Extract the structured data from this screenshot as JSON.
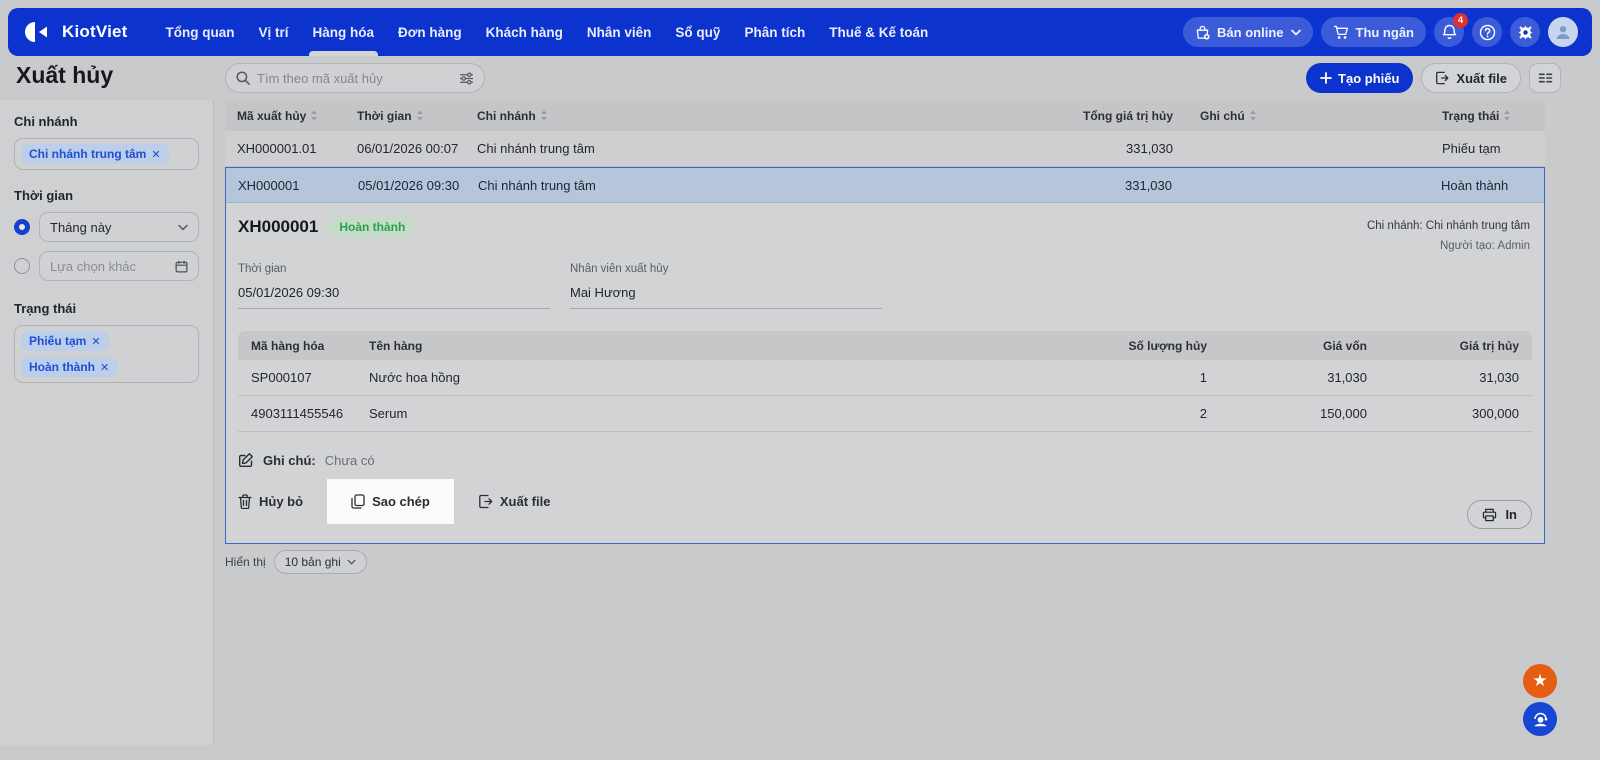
{
  "colors": {
    "brand_blue": "#0d33cf",
    "accent_blue": "#1c50d4",
    "notif_red": "#e03131",
    "badge_green_text": "#2f9e55",
    "badge_green_bg": "#c5ddc6",
    "selected_row_blue": "#b5c5db",
    "star_orange": "#e55d11"
  },
  "topbar": {
    "brand": "KiotViet",
    "nav": [
      {
        "label": "Tổng quan"
      },
      {
        "label": "Vị trí"
      },
      {
        "label": "Hàng hóa"
      },
      {
        "label": "Đơn hàng"
      },
      {
        "label": "Khách hàng"
      },
      {
        "label": "Nhân viên"
      },
      {
        "label": "Sổ quỹ"
      },
      {
        "label": "Phân tích"
      },
      {
        "label": "Thuế & Kế toán"
      }
    ],
    "ban_online": "Bán online",
    "thu_ngan": "Thu ngân",
    "notif_count": "4"
  },
  "header": {
    "title": "Xuất hủy",
    "search_placeholder": "Tìm theo mã xuất hủy",
    "create_btn": "Tạo phiếu",
    "export_btn": "Xuất file"
  },
  "sidebar": {
    "branch": {
      "label": "Chi nhánh",
      "chip": "Chi nhánh trung tâm"
    },
    "time": {
      "label": "Thời gian",
      "option_selected": "Tháng này",
      "option_other": "Lựa chọn khác"
    },
    "status": {
      "label": "Trạng thái",
      "chip1": "Phiếu tạm",
      "chip2": "Hoàn thành"
    }
  },
  "table": {
    "headers": {
      "code": "Mã xuất hủy",
      "time": "Thời gian",
      "branch": "Chi nhánh",
      "total": "Tổng giá trị hủy",
      "note": "Ghi chú",
      "status": "Trạng thái"
    },
    "rows": [
      {
        "code": "XH000001.01",
        "time": "06/01/2026 00:07",
        "branch": "Chi nhánh trung tâm",
        "total": "331,030",
        "note": "",
        "status": "Phiếu tạm"
      },
      {
        "code": "XH000001",
        "time": "05/01/2026 09:30",
        "branch": "Chi nhánh trung tâm",
        "total": "331,030",
        "note": "",
        "status": "Hoàn thành"
      }
    ]
  },
  "detail": {
    "code": "XH000001",
    "status_badge": "Hoàn thành",
    "branch_meta": "Chi nhánh: Chi nhánh trung tâm",
    "creator_meta": "Người tạo: Admin",
    "time_label": "Thời gian",
    "time_value": "05/01/2026 09:30",
    "staff_label": "Nhân viên xuất hủy",
    "staff_value": "Mai Hương",
    "items_headers": {
      "code": "Mã hàng hóa",
      "name": "Tên hàng",
      "qty": "Số lượng hủy",
      "cost": "Giá vốn",
      "value": "Giá trị hủy"
    },
    "items": [
      {
        "code": "SP000107",
        "name": "Nước hoa hồng",
        "qty": "1",
        "cost": "31,030",
        "value": "31,030"
      },
      {
        "code": "4903111455546",
        "name": "Serum",
        "qty": "2",
        "cost": "150,000",
        "value": "300,000"
      }
    ],
    "note_label": "Ghi chú:",
    "note_value": "Chưa có",
    "actions": {
      "cancel": "Hủy bỏ",
      "copy": "Sao chép",
      "export": "Xuất file",
      "print": "In"
    }
  },
  "footer": {
    "display_label": "Hiển thị",
    "page_size": "10 bản ghi"
  },
  "floating": {
    "star": "★"
  }
}
